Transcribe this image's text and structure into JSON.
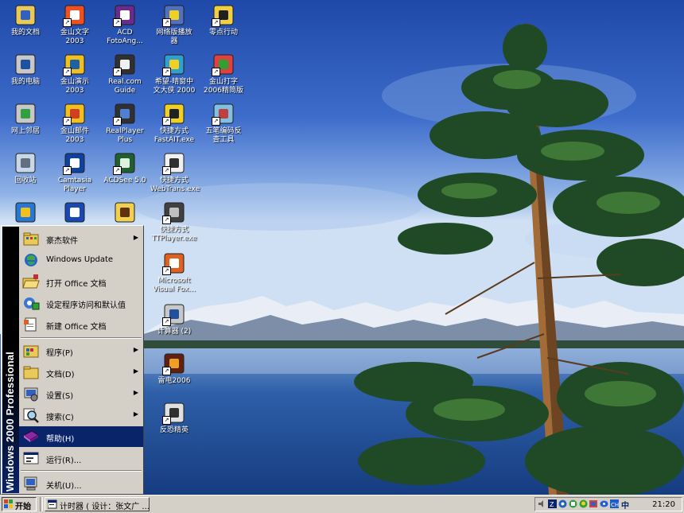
{
  "desktop_icons": [
    {
      "id": "my-documents",
      "label": "我的文档",
      "icon": "folder-documents-icon"
    },
    {
      "id": "wps-2003",
      "label": "金山文字\n2003",
      "icon": "wps-writer-icon"
    },
    {
      "id": "acd-fotoangelo",
      "label": "ACD\nFotoAng...",
      "icon": "acd-foto-icon"
    },
    {
      "id": "net-tv-player",
      "label": "网络版播放\n器",
      "icon": "media-player-icon"
    },
    {
      "id": "zero-action",
      "label": "零点行动",
      "icon": "game-soldier-icon"
    },
    {
      "id": "my-computer",
      "label": "我的电脑",
      "icon": "computer-icon"
    },
    {
      "id": "wps-presentation",
      "label": "金山演示\n2003",
      "icon": "wps-presentation-icon"
    },
    {
      "id": "realcom-guide",
      "label": "Real.com\nGuide",
      "icon": "real-guide-icon"
    },
    {
      "id": "hope-chinese",
      "label": "希望-晴窗中\n文大侠 2000",
      "icon": "chinese-input-icon"
    },
    {
      "id": "kingsoft-typing",
      "label": "金山打字\n2006精简版",
      "icon": "typing-tutor-icon"
    },
    {
      "id": "network-neighborhood",
      "label": "网上邻居",
      "icon": "network-icon"
    },
    {
      "id": "wps-mail",
      "label": "金山邮件\n2003",
      "icon": "mail-icon"
    },
    {
      "id": "realplayer-plus",
      "label": "RealPlayer\nPlus",
      "icon": "realplayer-icon"
    },
    {
      "id": "fastait-shortcut",
      "label": "快捷方式\nFastAIT.exe",
      "icon": "fastait-icon"
    },
    {
      "id": "wubi-tool",
      "label": "五笔编码反\n查工具",
      "icon": "wubi-tool-icon"
    },
    {
      "id": "recycle-bin",
      "label": "回收站",
      "icon": "recycle-bin-icon"
    },
    {
      "id": "camtasia-player",
      "label": "Camtasia\nPlayer",
      "icon": "camtasia-icon"
    },
    {
      "id": "acdsee-5",
      "label": "ACDSee 5.0",
      "icon": "acdsee-icon"
    },
    {
      "id": "webtrans-shortcut",
      "label": "快捷方式\nWebTrans.exe",
      "icon": "webtrans-icon"
    },
    {
      "id": "internet-explorer",
      "label": "",
      "icon": "ie-icon"
    },
    {
      "id": "blue-app",
      "label": "",
      "icon": "blue-circle-app-icon"
    },
    {
      "id": "smiley-app",
      "label": "",
      "icon": "smiley-icon"
    },
    {
      "id": "ttplayer-shortcut",
      "label": "快捷方式\nTTPlayer.exe",
      "icon": "headphones-icon"
    },
    {
      "id": "visual-foxpro",
      "label": "Microsoft\nVisual Fox...",
      "icon": "fox-icon"
    },
    {
      "id": "calculator-2",
      "label": "计算器 (2)",
      "icon": "calculator-icon"
    },
    {
      "id": "thunder-2006",
      "label": "雷电2006",
      "icon": "thunder-game-icon"
    },
    {
      "id": "counter-strike",
      "label": "反恐精英",
      "icon": "counter-strike-icon"
    }
  ],
  "start_menu": {
    "banner": "Windows 2000 Professional",
    "top_items": [
      {
        "label": "豪杰软件",
        "has_submenu": true,
        "icon": "programs-folder-icon"
      },
      {
        "label": "Windows Update",
        "has_submenu": false,
        "icon": "windows-update-icon"
      },
      {
        "label": "打开 Office 文档",
        "has_submenu": false,
        "icon": "open-office-folder-icon"
      },
      {
        "label": "设定程序访问和默认值",
        "has_submenu": false,
        "icon": "program-defaults-icon"
      },
      {
        "label": "新建 Office 文档",
        "has_submenu": false,
        "icon": "new-office-document-icon"
      }
    ],
    "main_items": [
      {
        "label": "程序(P)",
        "has_submenu": true,
        "icon": "programs-icon"
      },
      {
        "label": "文档(D)",
        "has_submenu": true,
        "icon": "documents-folder-icon"
      },
      {
        "label": "设置(S)",
        "has_submenu": true,
        "icon": "settings-icon"
      },
      {
        "label": "搜索(C)",
        "has_submenu": true,
        "icon": "search-icon"
      },
      {
        "label": "帮助(H)",
        "has_submenu": false,
        "icon": "help-book-icon",
        "highlighted": true
      },
      {
        "label": "运行(R)...",
        "has_submenu": false,
        "icon": "run-icon"
      }
    ],
    "shutdown_label": "关机(U)..."
  },
  "taskbar": {
    "start_label": "开始",
    "task_label": "计时器 ( 设计：张文广 ...",
    "tray_icons": [
      "speaker-icon",
      "input-method-icon",
      "network-tray-icon",
      "antivirus-icon",
      "qq-icon",
      "shield-tray-icon",
      "chat-tray-icon",
      "keyboard-tray-icon",
      "language-indicator-icon"
    ],
    "language_badge": "中",
    "clock": "21:20"
  }
}
